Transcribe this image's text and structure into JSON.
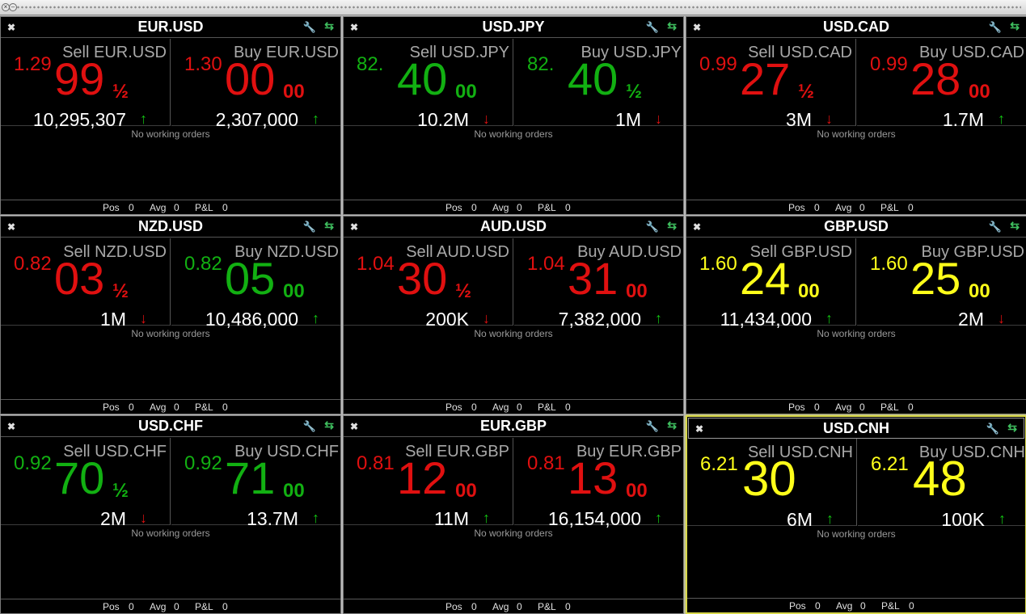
{
  "footer_labels": {
    "pos": "Pos",
    "avg": "Avg",
    "pnl": "P&L"
  },
  "icons": {
    "close": "close-icon",
    "settings": "wrench-icon",
    "swap": "swap-arrows-icon"
  },
  "colors": {
    "red": "#e01010",
    "green": "#12b012",
    "yellow": "#ffff1a",
    "selected_border": "#d8d84a"
  },
  "panels": [
    {
      "title": "EUR.USD",
      "selected": false,
      "orders_text": "No working orders",
      "pos": "0",
      "avg": "0",
      "pnl": "0",
      "sell": {
        "label": "Sell EUR.USD",
        "bigfig": "1.29",
        "pips": "99",
        "tail": "½",
        "size": "10,295,307",
        "arrow": "up",
        "color": "red"
      },
      "buy": {
        "label": "Buy EUR.USD",
        "bigfig": "1.30",
        "pips": "00",
        "tail": "00",
        "size": "2,307,000",
        "arrow": "up",
        "color": "red"
      }
    },
    {
      "title": "USD.JPY",
      "selected": false,
      "orders_text": "No working orders",
      "pos": "0",
      "avg": "0",
      "pnl": "0",
      "sell": {
        "label": "Sell USD.JPY",
        "bigfig": "82.",
        "pips": "40",
        "tail": "00",
        "size": "10.2M",
        "arrow": "down",
        "color": "green"
      },
      "buy": {
        "label": "Buy USD.JPY",
        "bigfig": "82.",
        "pips": "40",
        "tail": "½",
        "size": "1M",
        "arrow": "down",
        "color": "green"
      }
    },
    {
      "title": "USD.CAD",
      "selected": false,
      "orders_text": "No working orders",
      "pos": "0",
      "avg": "0",
      "pnl": "0",
      "sell": {
        "label": "Sell USD.CAD",
        "bigfig": "0.99",
        "pips": "27",
        "tail": "½",
        "size": "3M",
        "arrow": "down",
        "color": "red"
      },
      "buy": {
        "label": "Buy USD.CAD",
        "bigfig": "0.99",
        "pips": "28",
        "tail": "00",
        "size": "1.7M",
        "arrow": "up",
        "color": "red"
      }
    },
    {
      "title": "NZD.USD",
      "selected": false,
      "orders_text": "No working orders",
      "pos": "0",
      "avg": "0",
      "pnl": "0",
      "sell": {
        "label": "Sell NZD.USD",
        "bigfig": "0.82",
        "pips": "03",
        "tail": "½",
        "size": "1M",
        "arrow": "down",
        "color": "red"
      },
      "buy": {
        "label": "Buy NZD.USD",
        "bigfig": "0.82",
        "pips": "05",
        "tail": "00",
        "size": "10,486,000",
        "arrow": "up",
        "color": "green"
      }
    },
    {
      "title": "AUD.USD",
      "selected": false,
      "orders_text": "No working orders",
      "pos": "0",
      "avg": "0",
      "pnl": "0",
      "sell": {
        "label": "Sell AUD.USD",
        "bigfig": "1.04",
        "pips": "30",
        "tail": "½",
        "size": "200K",
        "arrow": "down",
        "color": "red"
      },
      "buy": {
        "label": "Buy AUD.USD",
        "bigfig": "1.04",
        "pips": "31",
        "tail": "00",
        "size": "7,382,000",
        "arrow": "up",
        "color": "red"
      }
    },
    {
      "title": "GBP.USD",
      "selected": false,
      "orders_text": "No working orders",
      "pos": "0",
      "avg": "0",
      "pnl": "0",
      "sell": {
        "label": "Sell GBP.USD",
        "bigfig": "1.60",
        "pips": "24",
        "tail": "00",
        "size": "11,434,000",
        "arrow": "up",
        "color": "yellow"
      },
      "buy": {
        "label": "Buy GBP.USD",
        "bigfig": "1.60",
        "pips": "25",
        "tail": "00",
        "size": "2M",
        "arrow": "down",
        "color": "yellow"
      }
    },
    {
      "title": "USD.CHF",
      "selected": false,
      "orders_text": "No working orders",
      "pos": "0",
      "avg": "0",
      "pnl": "0",
      "sell": {
        "label": "Sell USD.CHF",
        "bigfig": "0.92",
        "pips": "70",
        "tail": "½",
        "size": "2M",
        "arrow": "down",
        "color": "green"
      },
      "buy": {
        "label": "Buy USD.CHF",
        "bigfig": "0.92",
        "pips": "71",
        "tail": "00",
        "size": "13.7M",
        "arrow": "up",
        "color": "green"
      }
    },
    {
      "title": "EUR.GBP",
      "selected": false,
      "orders_text": "No working orders",
      "pos": "0",
      "avg": "0",
      "pnl": "0",
      "sell": {
        "label": "Sell EUR.GBP",
        "bigfig": "0.81",
        "pips": "12",
        "tail": "00",
        "size": "11M",
        "arrow": "up",
        "color": "red"
      },
      "buy": {
        "label": "Buy EUR.GBP",
        "bigfig": "0.81",
        "pips": "13",
        "tail": "00",
        "size": "16,154,000",
        "arrow": "up",
        "color": "red"
      }
    },
    {
      "title": "USD.CNH",
      "selected": true,
      "orders_text": "No working orders",
      "pos": "0",
      "avg": "0",
      "pnl": "0",
      "sell": {
        "label": "Sell USD.CNH",
        "bigfig": "6.21",
        "pips": "30",
        "tail": "",
        "size": "6M",
        "arrow": "up",
        "color": "yellow"
      },
      "buy": {
        "label": "Buy USD.CNH",
        "bigfig": "6.21",
        "pips": "48",
        "tail": "",
        "size": "100K",
        "arrow": "up",
        "color": "yellow"
      }
    }
  ]
}
